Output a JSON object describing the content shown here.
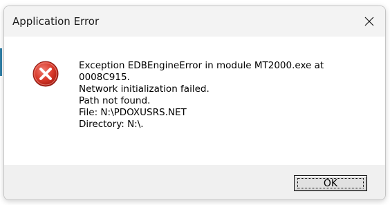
{
  "window": {
    "title": "Application Error",
    "close_icon": "close-icon"
  },
  "message": {
    "icon": "error-icon",
    "lines": [
      "Exception EDBEngineError in module MT2000.exe at",
      "0008C915.",
      "Network initialization failed.",
      "Path not found.",
      "File: N:\\PDOXUSRS.NET",
      "Directory: N:\\."
    ]
  },
  "buttons": {
    "ok_label": "OK"
  },
  "colors": {
    "error_red": "#d93a2b",
    "title_bar": "#f3f3f3",
    "footer": "#f0f0f0"
  }
}
